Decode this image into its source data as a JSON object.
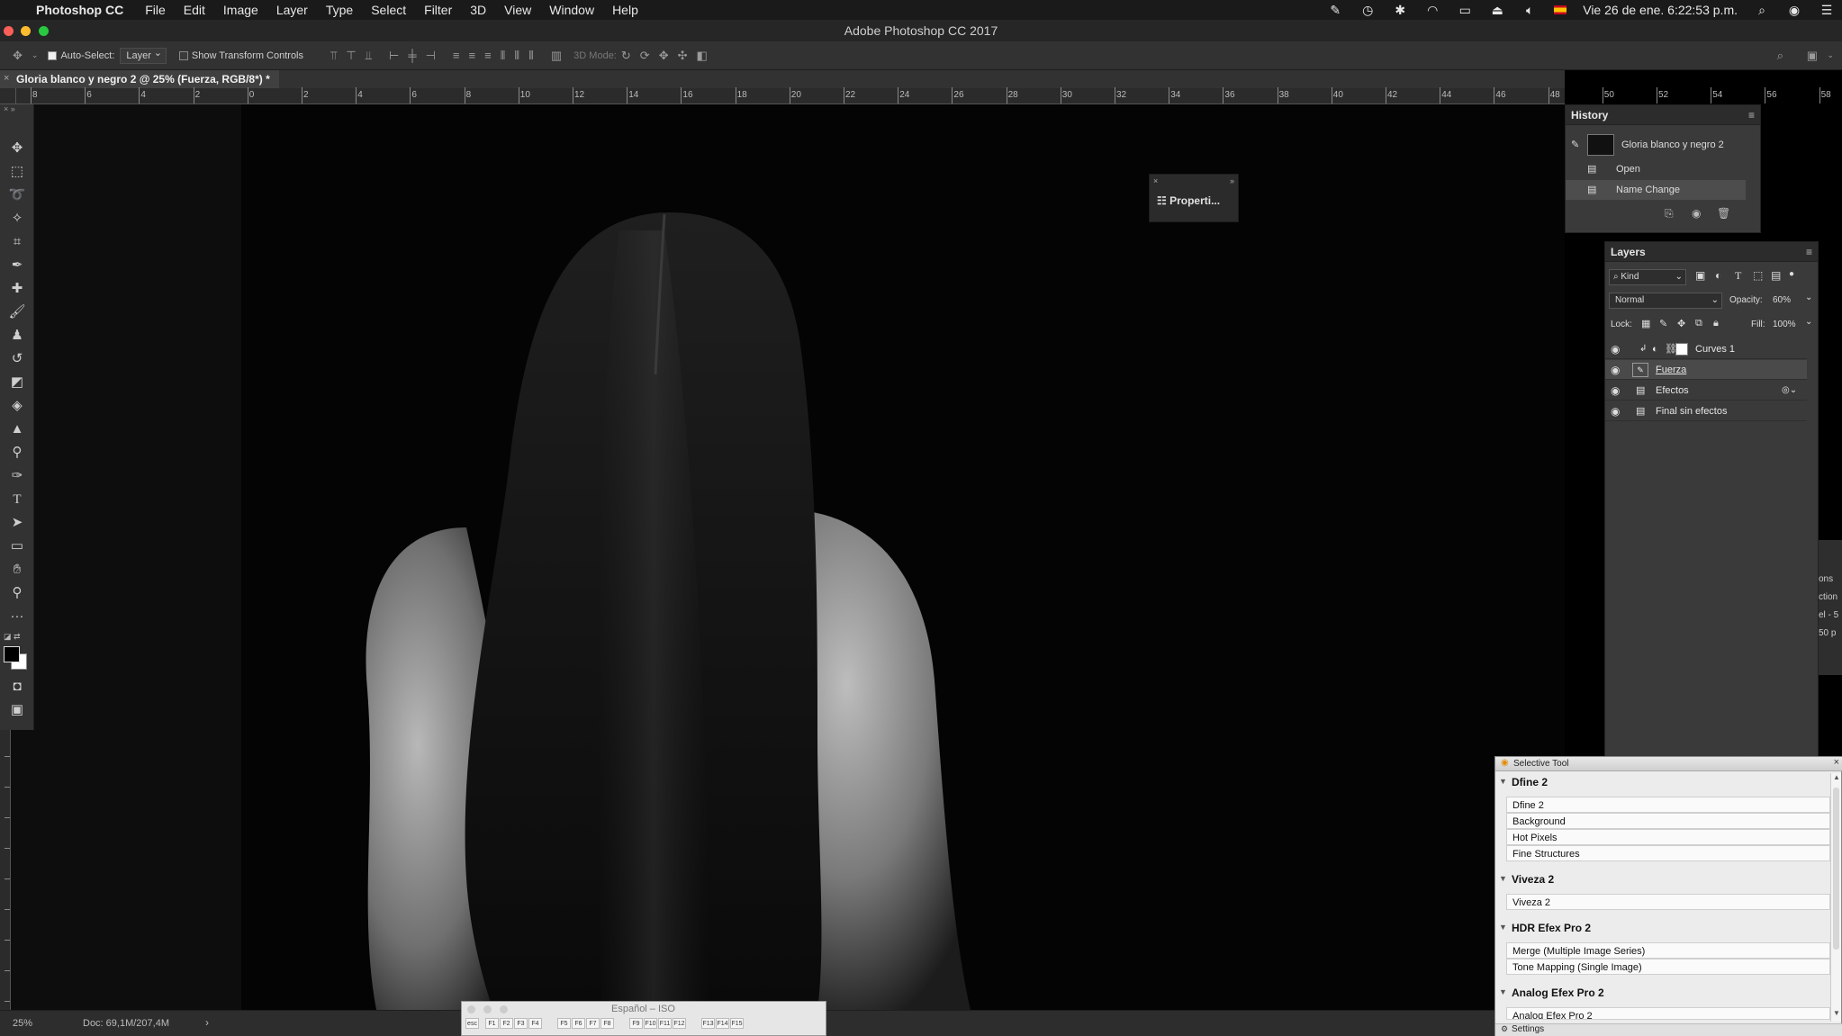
{
  "menubar": {
    "app_name": "Photoshop CC",
    "items": [
      "File",
      "Edit",
      "Image",
      "Layer",
      "Type",
      "Select",
      "Filter",
      "3D",
      "View",
      "Window",
      "Help"
    ],
    "clock": "Vie 26 de ene.  6:22:53 p.m."
  },
  "window": {
    "title": "Adobe Photoshop CC 2017"
  },
  "options": {
    "auto_select_label": "Auto-Select:",
    "auto_select_checked": true,
    "auto_select_target": "Layer",
    "show_transform_label": "Show Transform Controls",
    "mode_3d_label": "3D Mode:"
  },
  "document": {
    "tab_title": "Gloria blanco y negro 2 @ 25% (Fuerza, RGB/8*) *"
  },
  "ruler": {
    "labels": [
      "8",
      "6",
      "4",
      "2",
      "0",
      "2",
      "4",
      "6",
      "8",
      "10",
      "12",
      "14",
      "16",
      "18",
      "20",
      "22",
      "24",
      "26",
      "28",
      "30",
      "32",
      "34",
      "36",
      "38",
      "40",
      "42",
      "44",
      "46",
      "48",
      "50",
      "52",
      "54",
      "56",
      "58"
    ]
  },
  "status": {
    "zoom": "25%",
    "doc": "Doc: 69,1M/207,4M"
  },
  "history": {
    "title": "History",
    "snapshot": "Gloria blanco y negro 2",
    "steps": [
      "Open",
      "Name Change"
    ]
  },
  "properties": {
    "label": "Properti..."
  },
  "layers": {
    "title": "Layers",
    "filter_kind": "Kind",
    "blend_mode": "Normal",
    "opacity_label": "Opacity:",
    "opacity": "60%",
    "lock_label": "Lock:",
    "fill_label": "Fill:",
    "fill": "100%",
    "items": [
      {
        "name": "Curves 1",
        "visible": true,
        "selected": false
      },
      {
        "name": "Fuerza",
        "visible": true,
        "selected": true
      },
      {
        "name": "Efectos",
        "visible": true,
        "selected": false
      },
      {
        "name": "Final sin efectos",
        "visible": true,
        "selected": false
      }
    ]
  },
  "selective_tool": {
    "title": "Selective Tool",
    "sections": [
      {
        "name": "Dfine 2",
        "buttons": [
          "Dfine 2",
          "Background",
          "Hot Pixels",
          "Fine Structures"
        ]
      },
      {
        "name": "Viveza 2",
        "buttons": [
          "Viveza 2"
        ]
      },
      {
        "name": "HDR Efex Pro 2",
        "buttons": [
          "Merge (Multiple Image Series)",
          "Tone Mapping (Single Image)"
        ]
      },
      {
        "name": "Analog Efex Pro 2",
        "buttons": [
          "Analog Efex Pro 2"
        ]
      }
    ],
    "settings_label": "Settings"
  },
  "keyboard_viewer": {
    "title": "Español – ISO",
    "keys": [
      "esc",
      "F1",
      "F2",
      "F3",
      "F4",
      "F5",
      "F6",
      "F7",
      "F8",
      "F9",
      "F10",
      "F11",
      "F12",
      "F13",
      "F14",
      "F15"
    ]
  },
  "right_strip": {
    "fragments": [
      "ons",
      "ction",
      "el - 5",
      "50 p"
    ]
  },
  "colors": {
    "menubar_bg": "#1a1a1a",
    "panel_bg": "#3a3a3a",
    "workspace_bg": "#323232",
    "canvas_bg": "#000000",
    "selected_layer": "#4a4a4a",
    "close_red": "#fc5f57",
    "min_yellow": "#fdbc2e",
    "max_green": "#28c840"
  }
}
